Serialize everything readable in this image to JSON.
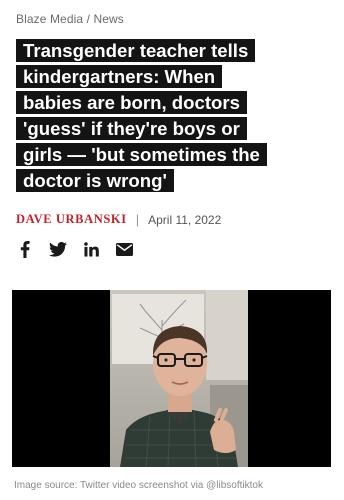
{
  "breadcrumb": {
    "site": "Blaze Media",
    "separator": "/",
    "section": "News"
  },
  "headline": {
    "lines": [
      "Transgender teacher tells",
      "kindergartners: When",
      "babies are born, doctors",
      "'guess' if they're boys or",
      "girls — 'but sometimes the",
      "doctor is wrong'"
    ]
  },
  "byline": {
    "author": "DAVE URBANSKI",
    "separator": "|",
    "date": "April 11, 2022"
  },
  "share": {
    "icons": [
      "facebook-icon",
      "twitter-icon",
      "linkedin-icon",
      "email-icon"
    ]
  },
  "colors": {
    "headline_bg": "#141414",
    "author": "#c4212b",
    "text_muted": "#8a8a8a"
  },
  "image": {
    "caption": "Image source: Twitter video screenshot via @libsoftiktok"
  }
}
